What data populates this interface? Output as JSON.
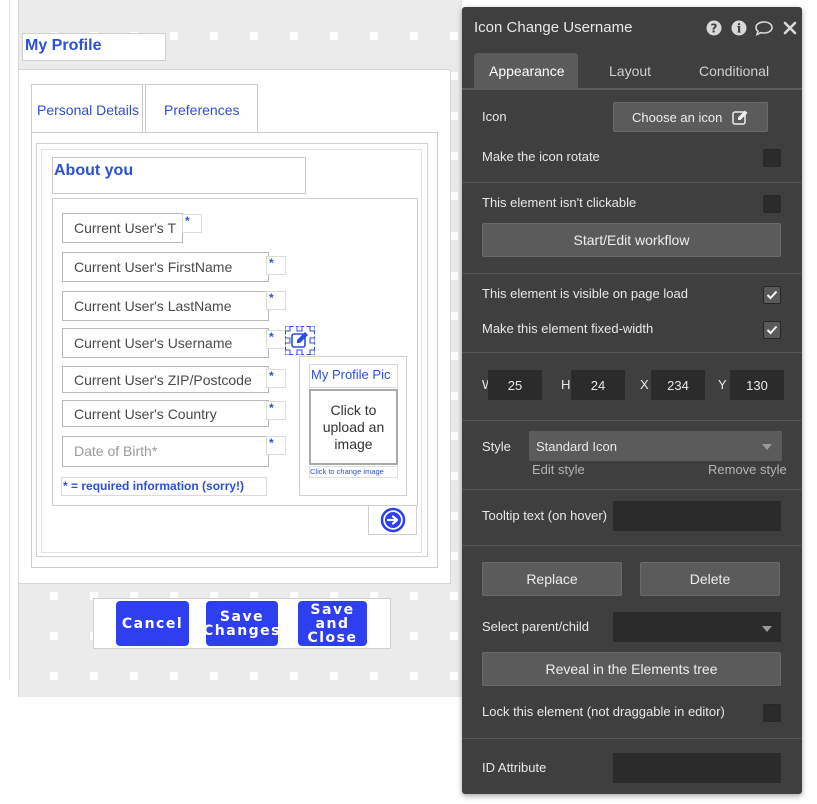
{
  "canvas": {
    "page_title": "My Profile",
    "tabs": [
      {
        "label": "Personal Details"
      },
      {
        "label": "Preferences"
      }
    ],
    "about_heading": "About you",
    "fields": [
      {
        "label": "Current User's T",
        "required": "*"
      },
      {
        "label": "Current User's FirstName",
        "required": "*"
      },
      {
        "label": "Current User's LastName",
        "required": "*"
      },
      {
        "label": "Current User's Username",
        "required": "*"
      },
      {
        "label": "Current User's ZIP/Postcode",
        "required": "*"
      },
      {
        "label": "Current User's Country",
        "required": "*"
      },
      {
        "placeholder": "Date of Birth*",
        "required": "*"
      }
    ],
    "required_note": "* = required information (sorry!)",
    "profile_pic": {
      "title": "My Profile Pic",
      "upload_text": "Click to upload an image",
      "change_link": "Click to change image"
    },
    "bottom_buttons": {
      "cancel": "Cancel",
      "save_changes": "Save Changes",
      "save_close": "Save and Close"
    },
    "colors": {
      "accent": "#2e3ff0",
      "label_blue": "#2c4fd8"
    }
  },
  "panel": {
    "title": "Icon Change Username",
    "header_icons": [
      "help-icon",
      "info-icon",
      "comment-icon",
      "close-icon"
    ],
    "tabs": [
      {
        "label": "Appearance",
        "active": true
      },
      {
        "label": "Layout",
        "active": false
      },
      {
        "label": "Conditional",
        "active": false
      }
    ],
    "icon_label": "Icon",
    "choose_icon": "Choose an icon",
    "rotate_label": "Make the icon rotate",
    "not_clickable_label": "This element isn't clickable",
    "workflow_button": "Start/Edit workflow",
    "visible_label": "This element is visible on page load",
    "fixed_width_label": "Make this element fixed-width",
    "checks": {
      "rotate": false,
      "not_clickable": false,
      "visible": true,
      "fixed_width": true
    },
    "dims": {
      "w_label": "W",
      "w": "25",
      "h_label": "H",
      "h": "24",
      "x_label": "X",
      "x": "234",
      "y_label": "Y",
      "y": "130"
    },
    "style_label": "Style",
    "style_value": "Standard Icon",
    "edit_style": "Edit style",
    "remove_style": "Remove style",
    "tooltip_label": "Tooltip text (on hover)",
    "tooltip_value": "",
    "replace_button": "Replace",
    "delete_button": "Delete",
    "select_parent_label": "Select parent/child",
    "select_parent_value": "",
    "reveal_button": "Reveal in the Elements tree",
    "lock_label": "Lock this element (not draggable in editor)",
    "id_label": "ID Attribute",
    "id_value": "",
    "colors": {
      "panel_bg": "#3f3f3f",
      "tab_active_bg": "#5b5b5b",
      "input_bg": "#2b2b2b"
    }
  }
}
